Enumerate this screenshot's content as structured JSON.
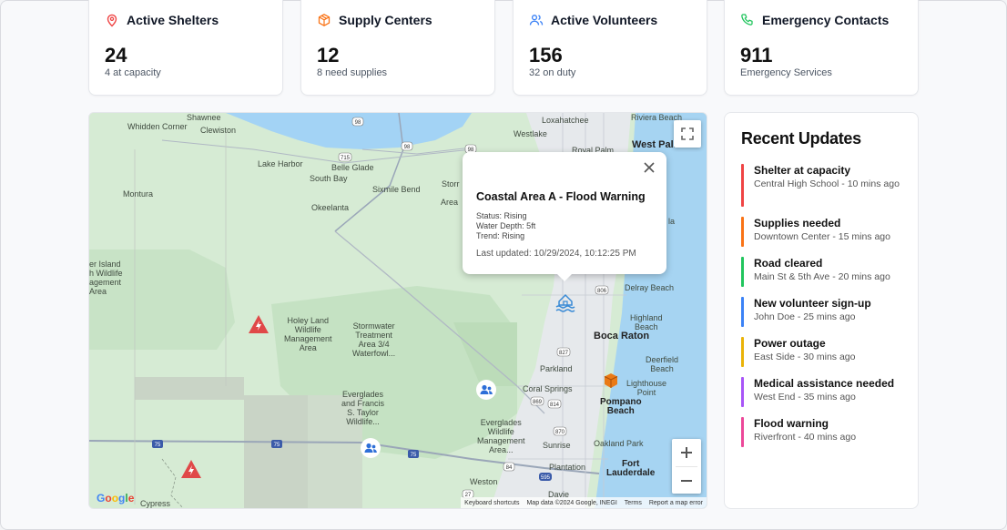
{
  "stats": [
    {
      "title": "Active Shelters",
      "value": "24",
      "sub": "4 at capacity",
      "icon": "map-pin-icon",
      "color": "#ef4444"
    },
    {
      "title": "Supply Centers",
      "value": "12",
      "sub": "8 need supplies",
      "icon": "package-icon",
      "color": "#f97316"
    },
    {
      "title": "Active Volunteers",
      "value": "156",
      "sub": "32 on duty",
      "icon": "users-icon",
      "color": "#3b82f6"
    },
    {
      "title": "Emergency Contacts",
      "value": "911",
      "sub": "Emergency Services",
      "icon": "phone-icon",
      "color": "#22c55e"
    }
  ],
  "map": {
    "labels": [
      "Whidden Corner",
      "Shawnee",
      "Clewiston",
      "Loxahatchee",
      "Riviera Beach",
      "Westlake",
      "Royal Palm",
      "West Palm",
      "Lake Harbor",
      "Belle Glade",
      "South Bay",
      "Sixmile Bend",
      "Montura",
      "Okeelanta",
      "Storr",
      "Area",
      "er Island\nh Wildlife\nagement\nArea",
      "Delray Beach",
      "Highland\nBeach",
      "Holey Land\nWildlife\nManagement\nArea",
      "Stormwater\nTreatment\nArea 3/4\nWaterfowl...",
      "Boca Raton",
      "Parkland",
      "Deerfield\nBeach",
      "Lighthouse\nPoint",
      "Coral Springs",
      "Pompano\nBeach",
      "Everglades\nand Francis\nS. Taylor\nWildlife...",
      "Everglades\nWildlife\nManagement\nArea...",
      "Sunrise",
      "Oakland Park",
      "Plantation",
      "Fort\nLauderdale",
      "Weston",
      "Davie",
      "Cypress",
      "la"
    ],
    "popup": {
      "title": "Coastal Area A - Flood Warning",
      "status": "Status: Rising",
      "depth": "Water Depth: 5ft",
      "trend": "Trend: Rising",
      "updated": "Last updated: 10/29/2024, 10:12:25 PM"
    },
    "attribution": {
      "shortcuts": "Keyboard shortcuts",
      "data": "Map data ©2024 Google, INEGI",
      "terms": "Terms",
      "report": "Report a map error"
    },
    "logo": "Google",
    "road_shields": [
      "98",
      "715",
      "98",
      "98",
      "806",
      "827",
      "869",
      "814",
      "870",
      "84",
      "595",
      "27",
      "75",
      "75",
      "75"
    ]
  },
  "updates": {
    "title": "Recent Updates",
    "items": [
      {
        "title": "Shelter at capacity",
        "sub": "Central High School - 10 mins ago",
        "color": "#ef4444"
      },
      {
        "title": "Supplies needed",
        "sub": "Downtown Center - 15 mins ago",
        "color": "#f97316"
      },
      {
        "title": "Road cleared",
        "sub": "Main St & 5th Ave - 20 mins ago",
        "color": "#22c55e"
      },
      {
        "title": "New volunteer sign-up",
        "sub": "John Doe - 25 mins ago",
        "color": "#3b82f6"
      },
      {
        "title": "Power outage",
        "sub": "East Side - 30 mins ago",
        "color": "#eab308"
      },
      {
        "title": "Medical assistance needed",
        "sub": "West End - 35 mins ago",
        "color": "#a855f7"
      },
      {
        "title": "Flood warning",
        "sub": "Riverfront - 40 mins ago",
        "color": "#ec4899"
      }
    ]
  }
}
